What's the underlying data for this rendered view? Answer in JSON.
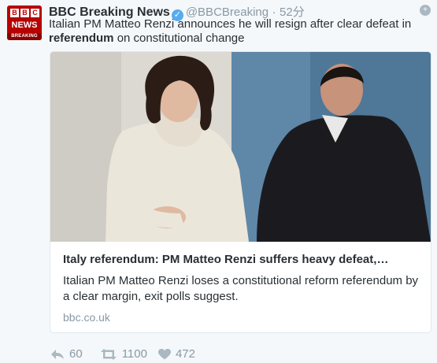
{
  "account": {
    "avatar_top": "BBC",
    "avatar_middle": "NEWS",
    "avatar_bottom": "BREAKING",
    "name": "BBC Breaking News",
    "handle": "@BBCBreaking",
    "separator": "·",
    "time": "52分"
  },
  "tweet": {
    "text_before": "Italian PM Matteo Renzi announces he will resign after clear defeat in ",
    "text_bold": "referendum",
    "text_after": " on constitutional change"
  },
  "card": {
    "title": "Italy referendum: PM Matteo Renzi suffers heavy defeat,…",
    "description": "Italian PM Matteo Renzi loses a constitutional reform referendum by a clear margin, exit polls suggest.",
    "domain": "bbc.co.uk"
  },
  "actions": {
    "reply_count": "60",
    "retweet_count": "1100",
    "like_count": "472"
  },
  "icons": {
    "verified": "verified-badge-icon",
    "follow": "follow-icon",
    "reply": "reply-icon",
    "retweet": "retweet-icon",
    "like": "heart-icon"
  },
  "colors": {
    "brand_red": "#b80000",
    "verified_blue": "#55acee",
    "muted_text": "#8899a6"
  }
}
